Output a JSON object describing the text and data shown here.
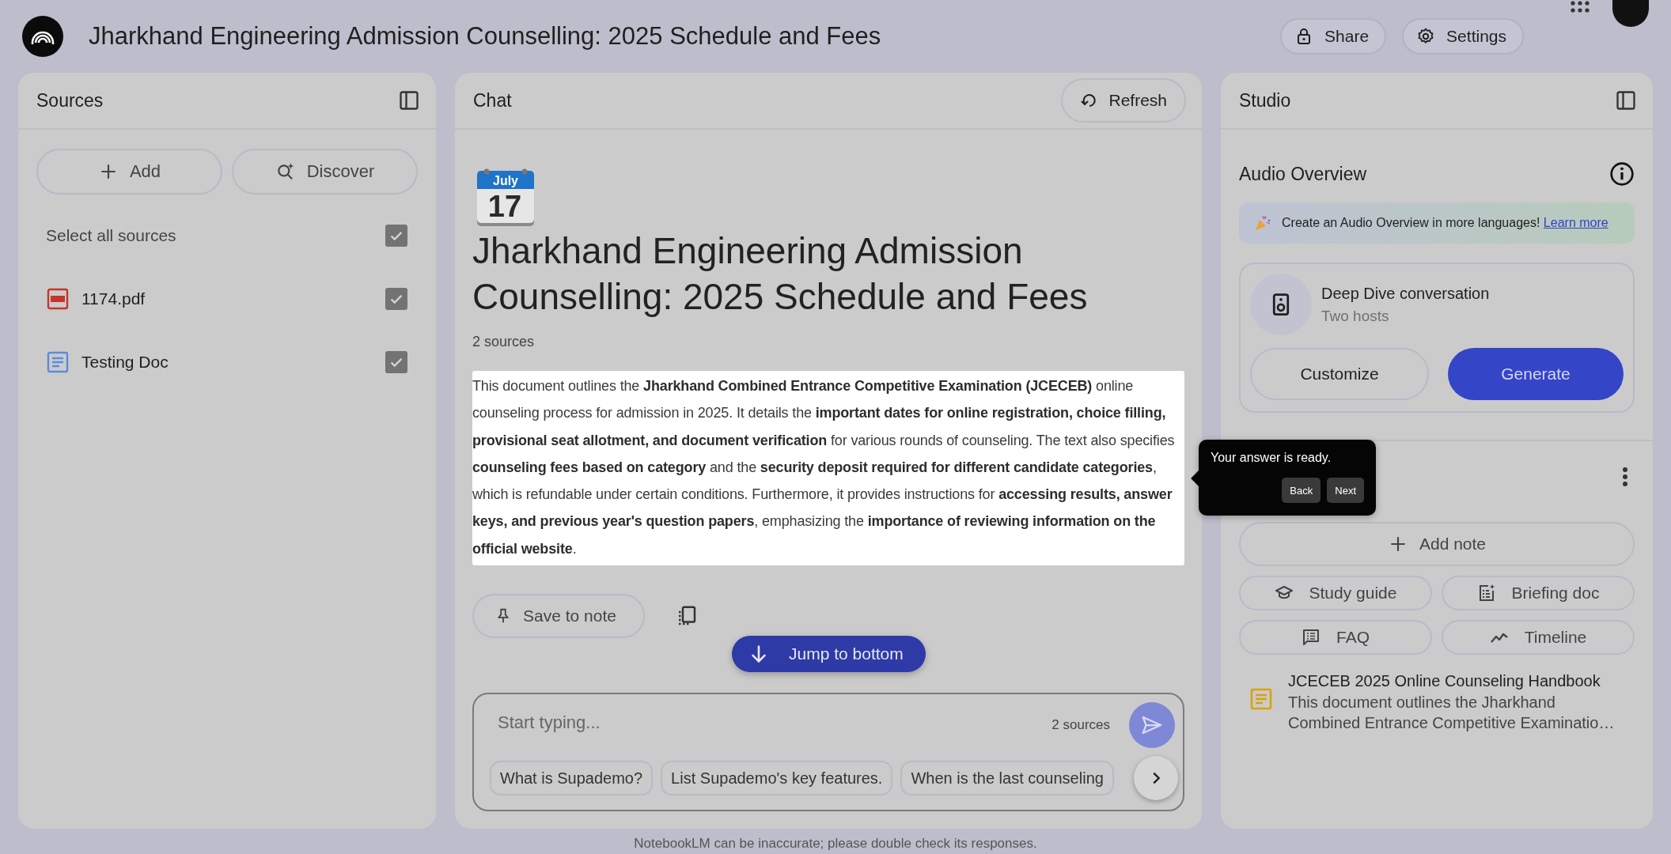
{
  "header": {
    "title": "Jharkhand Engineering Admission Counselling: 2025 Schedule and Fees"
  },
  "header_actions": [
    {
      "label": "Share"
    },
    {
      "label": "Settings"
    }
  ],
  "sources_panel": {
    "title": "Sources",
    "actions": [
      {
        "label": "Add"
      },
      {
        "label": "Discover"
      }
    ],
    "select_all": {
      "label": "Select all sources",
      "checked": true
    },
    "items": [
      {
        "name": "1174.pdf",
        "kind": "pdf",
        "checked": true
      },
      {
        "name": "Testing Doc",
        "kind": "doc",
        "checked": true
      }
    ]
  },
  "chat_panel": {
    "title": "Chat",
    "refresh_label": "Refresh",
    "calendar": {
      "month": "July",
      "day": "17"
    },
    "heading": "Jharkhand Engineering Admission Counselling: 2025 Schedule and Fees",
    "source_count": "2 sources",
    "summary": "This document outlines the **Jharkhand Combined Entrance Competitive Examination (JCECEB)** online counseling process for admission in 2025. It details the **important dates for online registration, choice filling, provisional seat allotment, and document verification** for various rounds of counseling. The text also specifies **counseling fees based on category** and the **security deposit required for different candidate categories**, which is refundable under certain conditions. Furthermore, it provides instructions for **accessing results, answer keys, and previous year's question papers**, emphasizing the **importance of reviewing information on the official website**.",
    "save_label": "Save to note",
    "jump_label": "Jump to bottom",
    "input": {
      "placeholder": "Start typing...",
      "source_count": "2 sources"
    },
    "suggestions": [
      "What is Supademo?",
      "List Supademo's key features.",
      "When is the last counseling"
    ]
  },
  "studio_panel": {
    "title": "Studio",
    "audio_title": "Audio Overview",
    "banner": {
      "text": "Create an Audio Overview in more languages!",
      "link": "Learn more"
    },
    "audio_card": {
      "title": "Deep Dive conversation",
      "subtitle": "Two hosts",
      "buttons": [
        {
          "label": "Customize",
          "kind": "outline"
        },
        {
          "label": "Generate",
          "kind": "primary"
        }
      ]
    },
    "add_note_label": "Add note",
    "note_actions": [
      {
        "label": "Study guide"
      },
      {
        "label": "Briefing doc"
      },
      {
        "label": "FAQ"
      },
      {
        "label": "Timeline"
      }
    ],
    "notes": [
      {
        "title": "JCECEB 2025 Online Counseling Handbook",
        "preview": "This document outlines the Jharkhand Combined Entrance Competitive Examinatio…"
      }
    ]
  },
  "tour_tooltip": {
    "message": "Your answer is ready.",
    "buttons": [
      "Back",
      "Next"
    ]
  },
  "footer": "NotebookLM can be inaccurate; please double check its responses."
}
